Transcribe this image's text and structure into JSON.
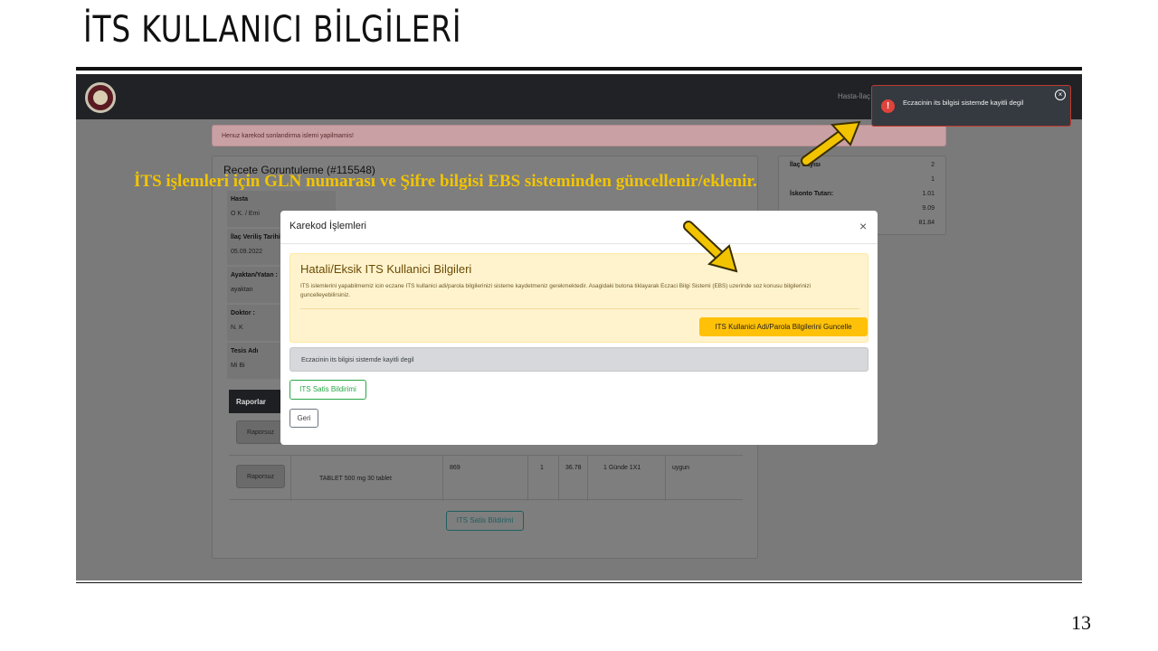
{
  "slide": {
    "title": "İTS KULLANICI BİLGİLERİ",
    "page_number": "13",
    "caption": "İTS işlemleri için GLN numarası ve Şifre bilgisi EBS sisteminden güncellenir/eklenir.",
    "arrow_color": "#f2c400"
  },
  "app": {
    "nav_user": "Hasta-İlaç S",
    "alert_top": "Henuz karekod sonlandirma islemi yapilmamis!",
    "recete_title": "Recete Goruntuleme (#115548)",
    "patient": {
      "label": "Hasta",
      "value": "O      K.      / Emi"
    },
    "verilis": {
      "label": "İlaç Veriliş Tarihi",
      "value": "05.09.2022"
    },
    "ayaktan": {
      "label": "Ayaktan/Yatan :",
      "value": "ayaktan"
    },
    "doktor": {
      "label": "Doktor :",
      "value": "N.       K"
    },
    "tesis": {
      "label": "Tesis Adı",
      "value": "Mi        Bi"
    },
    "raporlar_label": "Raporlar",
    "raporsuz_label": "Raporsuz",
    "drug_row": {
      "name": "TABLET 500 mg 30 tablet",
      "code": "869",
      "qty": "1",
      "price": "36.78",
      "dose": "1 Günde 1X1",
      "status": "uygun"
    },
    "its_satis_bottom": "ITS Satis Bildirimi"
  },
  "summary": {
    "ilac_sayisi_label": "İlaç Sayısı",
    "ilac_sayisi_value": "2",
    "row2_value": "1",
    "iskonto_label": "İskonto Tutarı:",
    "iskonto_value": "1.01",
    "row4_value": "9.09",
    "row5_value": "81.84"
  },
  "modal": {
    "title": "Karekod İşlemleri",
    "close": "×",
    "warning_title": "Hatali/Eksik ITS Kullanici Bilgileri",
    "warning_text": "ITS islemlerini yapabilmemiz icin eczane ITS kullanici adi/parola bilgilerinizi sisteme kaydetmeniz gerekmektedir. Asagidaki butona tiklayarak Eczaci Bilgi Sistemi (EBS) uzerinde soz konusu bilgilerinizi guncelleyebilirsiniz.",
    "update_button": "ITS Kullanici Adi/Parola Bilgilerini Guncelle",
    "info_message": "Eczacinin its bilgisi sistemde kayitli degil",
    "its_satis_button": "ITS Satis Bildirimi",
    "geri_button": "Geri"
  },
  "toast": {
    "icon": "!",
    "message": "Eczacinin its bilgisi sistemde kayitli degil",
    "close": "×"
  }
}
